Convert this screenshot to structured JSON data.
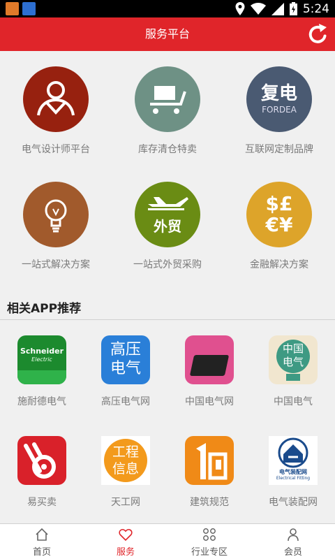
{
  "status_bar": {
    "time": "5:24"
  },
  "header": {
    "title": "服务平台"
  },
  "services": [
    {
      "label": "电气设计师平台",
      "icon": "designer-icon",
      "color": "#97210f"
    },
    {
      "label": "库存清仓特卖",
      "icon": "cart-icon",
      "color": "#6e9185"
    },
    {
      "label": "互联网定制品牌",
      "icon": "fordea-logo",
      "color": "#4a5a72",
      "logo_cn": "复电",
      "logo_en": "FORDEA"
    },
    {
      "label": "一站式解决方案",
      "icon": "lightbulb-icon",
      "color": "#a15a2c"
    },
    {
      "label": "一站式外贸采购",
      "icon": "airplane-icon",
      "color": "#6a8c14",
      "badge": "外贸"
    },
    {
      "label": "金融解决方案",
      "icon": "currency-icon",
      "color": "#dda42a",
      "symbols": "$£€¥"
    }
  ],
  "apps_section": {
    "title": "相关APP推荐"
  },
  "apps": [
    {
      "label": "施耐德电气",
      "icon": "schneider-icon",
      "brand": "Schneider",
      "brand_sub": "Electric"
    },
    {
      "label": "高压电气网",
      "icon": "gaoya-icon",
      "logo_line1": "高压",
      "logo_line2": "电气"
    },
    {
      "label": "中国电气网",
      "icon": "induction-cooker-icon"
    },
    {
      "label": "中国电气",
      "icon": "china-electric-icon",
      "logo_line1": "中国",
      "logo_line2": "电气"
    },
    {
      "label": "易买卖",
      "icon": "yimaimai-icon"
    },
    {
      "label": "天工网",
      "icon": "tiangong-icon",
      "logo_line1": "工程",
      "logo_line2": "信息"
    },
    {
      "label": "建筑规范",
      "icon": "jianzhu-icon"
    },
    {
      "label": "电气装配网",
      "icon": "zhuangpei-icon",
      "logo_cn": "电气装配网",
      "logo_en": "Electrical Fitting"
    }
  ],
  "bottom_nav": [
    {
      "label": "首页",
      "icon": "home-icon",
      "active": false
    },
    {
      "label": "服务",
      "icon": "heart-icon",
      "active": true
    },
    {
      "label": "行业专区",
      "icon": "grid-icon",
      "active": false
    },
    {
      "label": "会员",
      "icon": "user-icon",
      "active": false
    }
  ],
  "colors": {
    "header": "#e0252a",
    "accent": "#e0252a",
    "background": "#f0f0f0"
  }
}
